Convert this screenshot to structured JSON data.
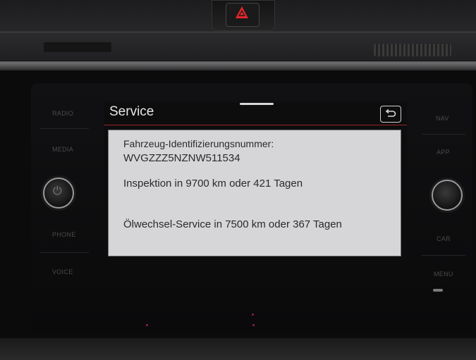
{
  "dashboard": {
    "hazard_icon": "hazard-warning-triangle-icon",
    "accent_red": "#e3262c"
  },
  "left_buttons": [
    "RADIO",
    "MEDIA",
    "PHONE",
    "VOICE"
  ],
  "right_buttons": [
    "NAV",
    "APP",
    "CAR",
    "MENU"
  ],
  "screen": {
    "title": "Service",
    "back_icon": "back-arrow-icon",
    "accent_color": "#9b2424",
    "lines": {
      "vin_label": "Fahrzeug-Identifizierungsnummer:",
      "vin_value": "WVGZZZ5NZNW511534",
      "inspection": "Inspektion in 9700 km oder 421 Tagen",
      "oil_service": "Ölwechsel-Service in 7500 km oder 367 Tagen"
    }
  },
  "knobs": {
    "left_symbol": "power-icon",
    "right_symbol": "tune-knob"
  }
}
